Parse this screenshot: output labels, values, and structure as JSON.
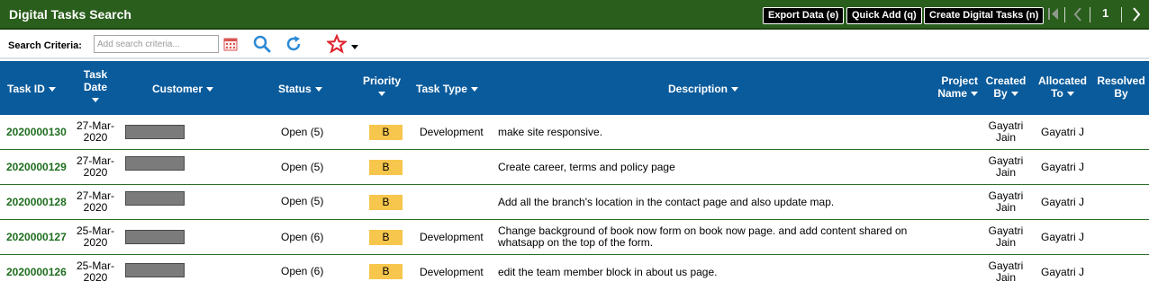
{
  "app": {
    "title": "Digital Tasks Search"
  },
  "toolbar": {
    "export_label": "Export Data (e)",
    "quick_add_label": "Quick Add (q)",
    "create_label": "Create Digital Tasks (n)",
    "page_number": "1"
  },
  "search": {
    "label": "Search Criteria:",
    "placeholder": "Add search criteria...",
    "value": ""
  },
  "icons": {
    "calendar": "calendar-icon",
    "search": "search-icon",
    "refresh": "refresh-icon",
    "favorite": "star-icon",
    "first_page": "first-page-icon",
    "prev_page": "chevron-left-icon",
    "next_page": "chevron-right-icon"
  },
  "colors": {
    "titlebar": "#2a5e1c",
    "table_header": "#0a5b9c",
    "task_id": "#1e6d1e",
    "priority_badge": "#f7c64c",
    "accent_blue": "#2b8ad6",
    "star": "#e0202a"
  },
  "columns": {
    "task_id": "Task ID",
    "task_date": "Task Date",
    "customer": "Customer",
    "status": "Status",
    "priority": "Priority",
    "task_type": "Task Type",
    "description": "Description",
    "project_name": "Project Name",
    "created_by": "Created By",
    "allocated_to": "Allocated To",
    "resolved_by": "Resolved By"
  },
  "rows": [
    {
      "id": "2020000130",
      "date": "27-Mar-2020",
      "status": "Open (5)",
      "priority": "B",
      "type": "Development",
      "description": "make site responsive.",
      "project": "",
      "created_by": "Gayatri Jain",
      "allocated_to": "Gayatri J",
      "resolved_by": ""
    },
    {
      "id": "2020000129",
      "date": "27-Mar-2020",
      "status": "Open (5)",
      "priority": "B",
      "type": "",
      "description": "Create career, terms and policy page",
      "project": "",
      "created_by": "Gayatri Jain",
      "allocated_to": "Gayatri J",
      "resolved_by": ""
    },
    {
      "id": "2020000128",
      "date": "27-Mar-2020",
      "status": "Open (5)",
      "priority": "B",
      "type": "",
      "description": "Add all the branch's location in the contact page and also update map.",
      "project": "",
      "created_by": "Gayatri Jain",
      "allocated_to": "Gayatri J",
      "resolved_by": ""
    },
    {
      "id": "2020000127",
      "date": "25-Mar-2020",
      "status": "Open (6)",
      "priority": "B",
      "type": "Development",
      "description": "Change background of book now form on book now page. and add content shared on whatsapp on the top of the form.",
      "project": "",
      "created_by": "Gayatri Jain",
      "allocated_to": "Gayatri J",
      "resolved_by": ""
    },
    {
      "id": "2020000126",
      "date": "25-Mar-2020",
      "status": "Open (6)",
      "priority": "B",
      "type": "Development",
      "description": "edit the team member block in about us page.",
      "project": "",
      "created_by": "Gayatri Jain",
      "allocated_to": "Gayatri J",
      "resolved_by": ""
    }
  ]
}
